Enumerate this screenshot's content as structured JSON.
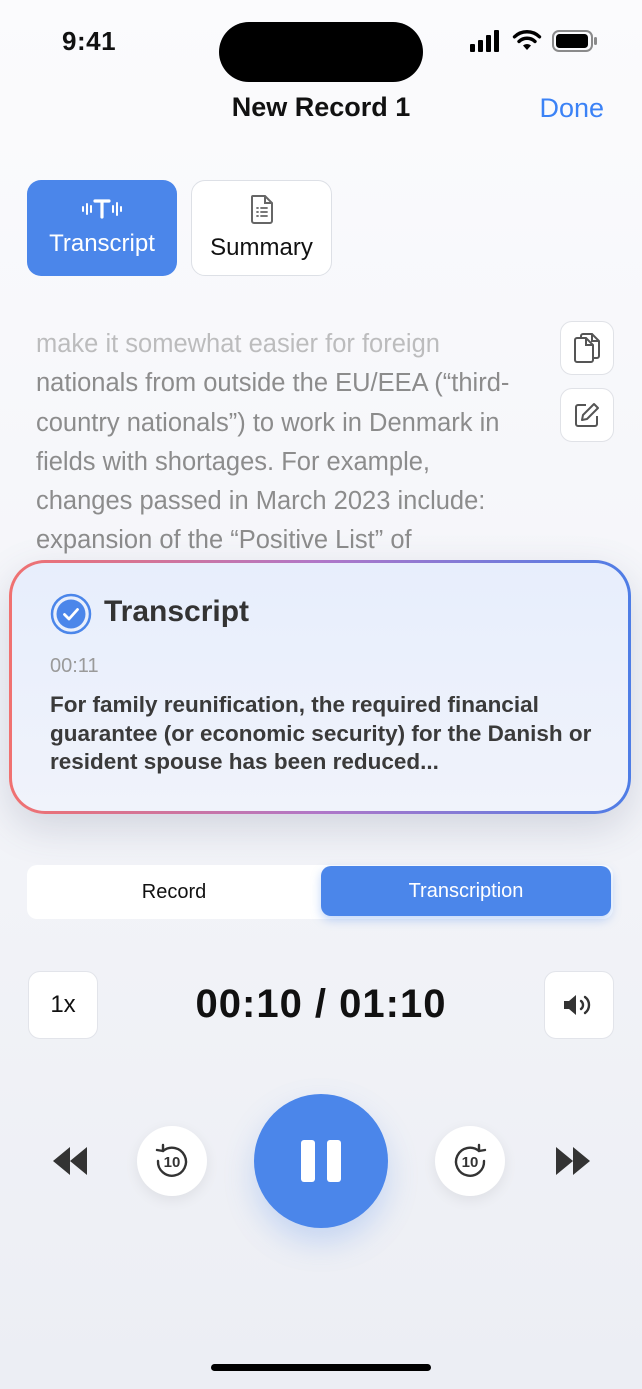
{
  "status": {
    "time": "9:41"
  },
  "header": {
    "title": "New Record 1",
    "done_label": "Done"
  },
  "tabs": [
    {
      "label": "Transcript",
      "icon": "waveform-text-icon",
      "active": true
    },
    {
      "label": "Summary",
      "icon": "document-list-icon",
      "active": false
    }
  ],
  "transcript_body": {
    "lines": [
      "make it somewhat easier for foreign",
      "nationals from outside the EU/EEA (“third-",
      "country nationals”) to work in Denmark in",
      "fields with shortages. For example,",
      "changes passed in March 2023 include:",
      "expansion of the “Positive List” of"
    ]
  },
  "card": {
    "title": "Transcript",
    "timestamp": "00:11",
    "text": "For family reunification, the required financial guarantee (or economic security) for the Danish or resident spouse has been reduced..."
  },
  "segment": {
    "record_label": "Record",
    "transcription_label": "Transcription",
    "selected": "Transcription"
  },
  "player": {
    "speed": "1x",
    "time": "00:10 / 01:10",
    "skip_back": "10",
    "skip_forward": "10"
  },
  "colors": {
    "accent": "#4b86ea",
    "link": "#3b82f6"
  }
}
